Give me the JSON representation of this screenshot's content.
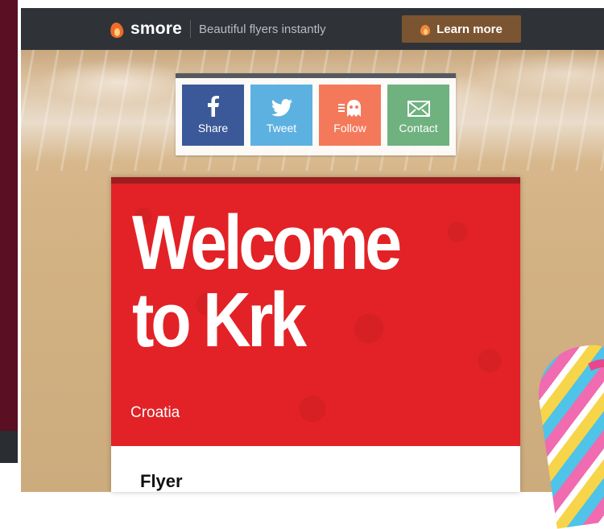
{
  "header": {
    "brand": "smore",
    "tagline": "Beautiful flyers instantly",
    "learn_more": "Learn more"
  },
  "share": {
    "buttons": [
      {
        "label": "Share",
        "icon": "facebook-icon"
      },
      {
        "label": "Tweet",
        "icon": "twitter-icon"
      },
      {
        "label": "Follow",
        "icon": "follow-icon"
      },
      {
        "label": "Contact",
        "icon": "envelope-icon"
      }
    ]
  },
  "flyer": {
    "title": "Welcome to Krk",
    "subtitle": "Croatia",
    "section_title": "Flyer"
  },
  "colors": {
    "topbar": "#2f3338",
    "learn_more_bg": "#7b5532",
    "facebook": "#3b5998",
    "twitter": "#5db1e0",
    "follow": "#f4795b",
    "contact": "#6fb17f",
    "hero_red": "#e22226"
  }
}
